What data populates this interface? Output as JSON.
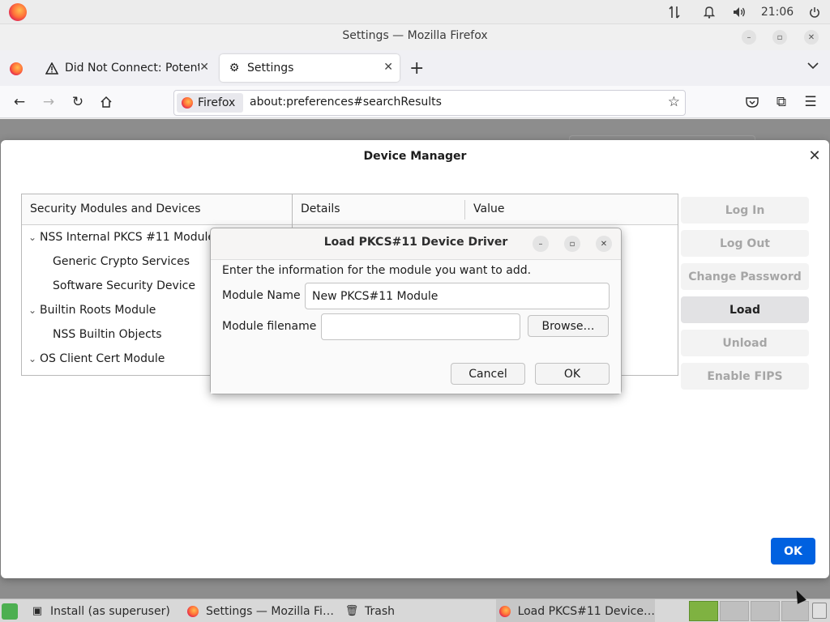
{
  "system_panel": {
    "clock": "21:06",
    "icons": [
      "firefox-icon",
      "network-icon",
      "notification-bell-icon",
      "volume-icon",
      "power-icon"
    ]
  },
  "window": {
    "title": "Settings — Mozilla Firefox"
  },
  "tabs": [
    {
      "label": "Did Not Connect: Potenti",
      "icon": "warning-icon",
      "active": false
    },
    {
      "label": "Settings",
      "icon": "gear-icon",
      "active": true
    }
  ],
  "urlbar": {
    "identity_label": "Firefox",
    "url": "about:preferences#searchResults"
  },
  "device_manager": {
    "title": "Device Manager",
    "tree_header": "Security Modules and Devices",
    "tree": [
      {
        "label": "NSS Internal PKCS #11 Module",
        "level": 0
      },
      {
        "label": "Generic Crypto Services",
        "level": 1
      },
      {
        "label": "Software Security Device",
        "level": 1
      },
      {
        "label": "Builtin Roots Module",
        "level": 0
      },
      {
        "label": "NSS Builtin Objects",
        "level": 1
      },
      {
        "label": "OS Client Cert Module",
        "level": 0
      }
    ],
    "details_header": "Details",
    "value_header": "Value",
    "buttons": {
      "log_in": "Log In",
      "log_out": "Log Out",
      "change_password": "Change Password",
      "load": "Load",
      "unload": "Unload",
      "enable_fips": "Enable FIPS"
    },
    "ok_label": "OK"
  },
  "load_dialog": {
    "title": "Load PKCS#11 Device Driver",
    "intro": "Enter the information for the module you want to add.",
    "module_name_label": "Module Name",
    "module_name_value": "New PKCS#11 Module",
    "module_filename_label": "Module filename",
    "module_filename_value": "",
    "browse_label": "Browse…",
    "cancel_label": "Cancel",
    "ok_label": "OK"
  },
  "taskbar": {
    "items": [
      {
        "label": "Install (as superuser)",
        "icon": "installer-icon"
      },
      {
        "label": "Settings — Mozilla Fi…",
        "icon": "firefox-icon"
      },
      {
        "label": "Trash",
        "icon": "trash-icon"
      },
      {
        "label": "Load PKCS#11 Device…",
        "icon": "firefox-icon"
      }
    ]
  },
  "colors": {
    "primary_button": "#0061e0",
    "active_workspace": "#7fb241"
  }
}
